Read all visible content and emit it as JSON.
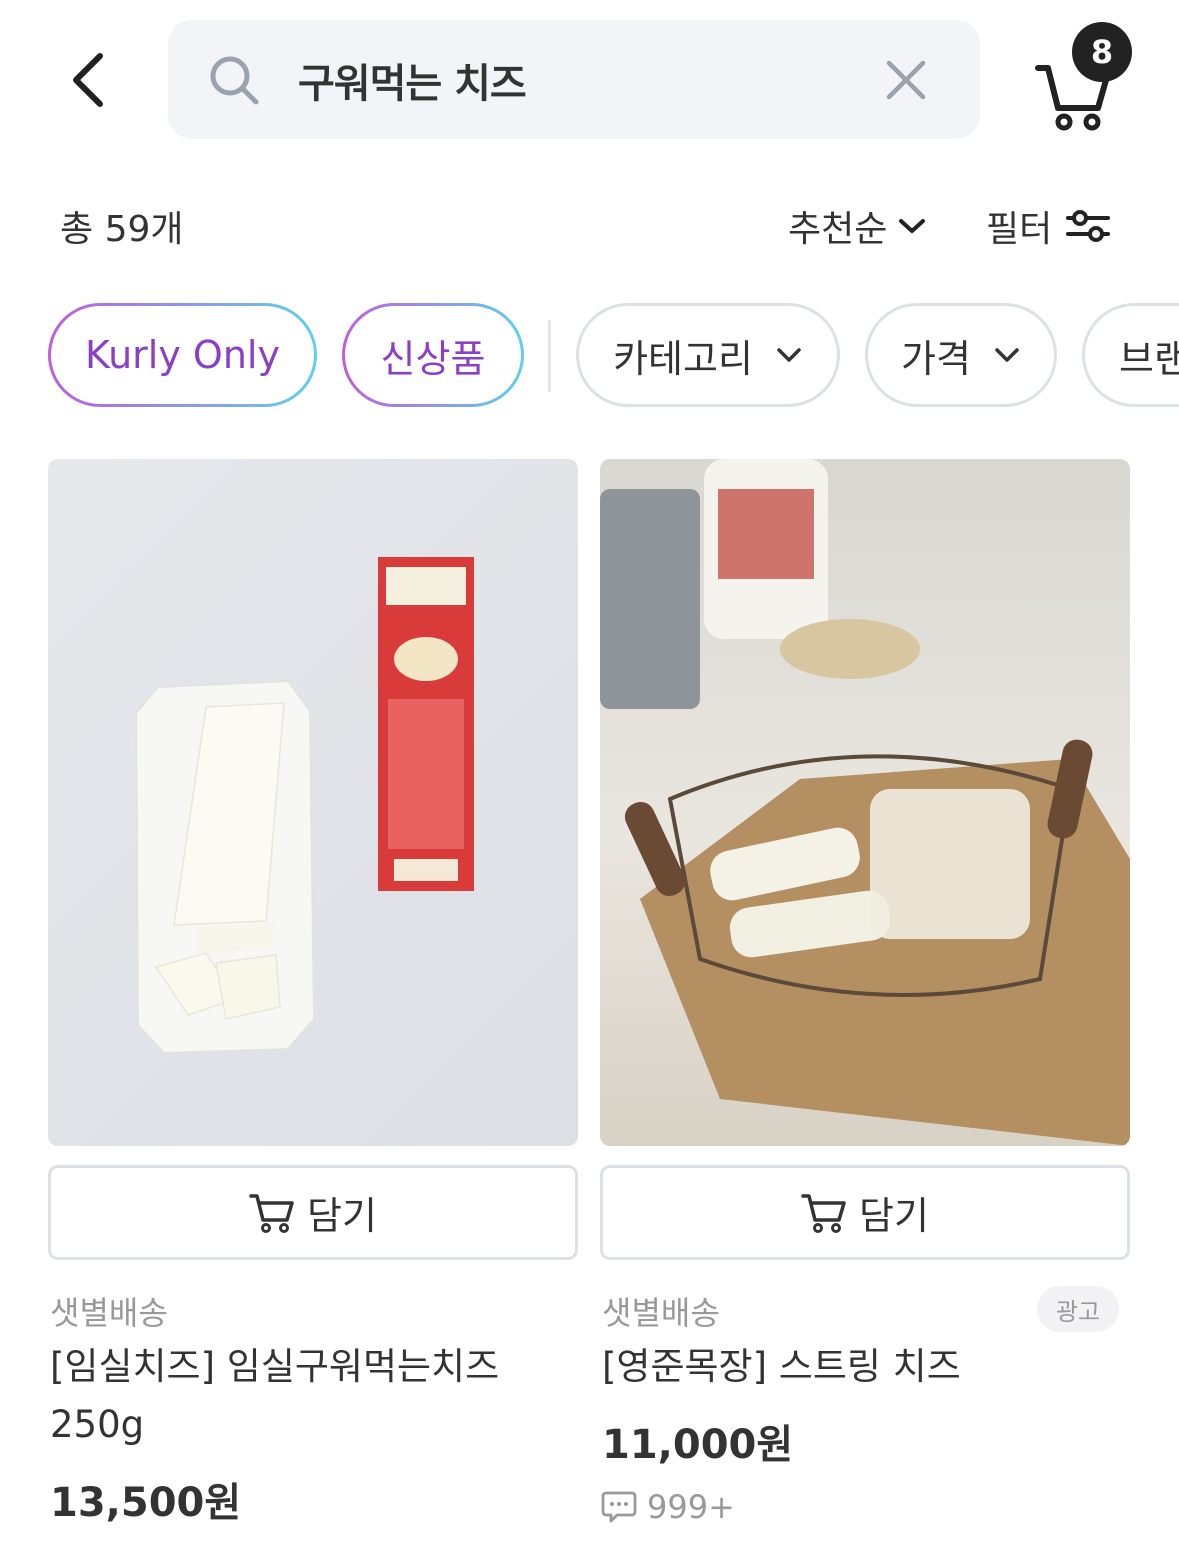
{
  "search": {
    "query": "구워먹는 치즈"
  },
  "cart": {
    "count": "8"
  },
  "results": {
    "total_label": "총 59개",
    "sort_label": "추천순",
    "filter_label": "필터"
  },
  "chips": [
    {
      "label": "Kurly Only"
    },
    {
      "label": "신상품"
    },
    {
      "label": "카테고리"
    },
    {
      "label": "가격"
    },
    {
      "label": "브랜드"
    }
  ],
  "products": [
    {
      "add_label": "담기",
      "delivery": "샛별배송",
      "name_line1": "[임실치즈] 임실구워먹는치즈",
      "name_line2": "250g",
      "price": "13,500원"
    },
    {
      "add_label": "담기",
      "delivery": "샛별배송",
      "ad": "광고",
      "name_line1": "[영준목장] 스트링 치즈",
      "price": "11,000원",
      "reviews": "999+"
    }
  ],
  "colors": {
    "accent_purple": "#8b3fc8",
    "accent_cyan": "#5fd0ec",
    "search_bg": "#f2f4f7"
  }
}
